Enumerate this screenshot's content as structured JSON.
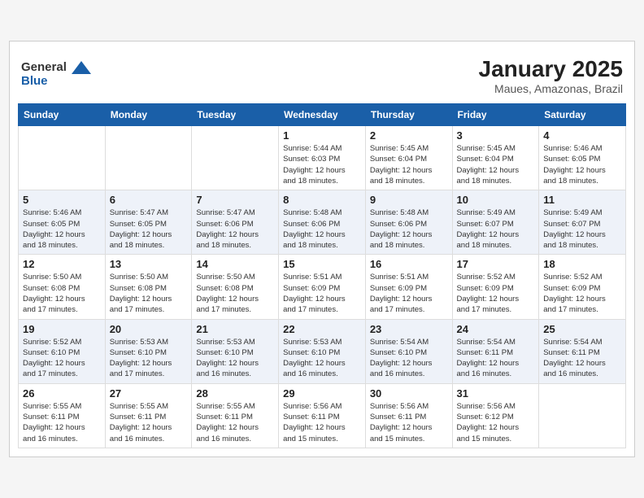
{
  "header": {
    "logo_general": "General",
    "logo_blue": "Blue",
    "title": "January 2025",
    "subtitle": "Maues, Amazonas, Brazil"
  },
  "weekdays": [
    "Sunday",
    "Monday",
    "Tuesday",
    "Wednesday",
    "Thursday",
    "Friday",
    "Saturday"
  ],
  "rows": [
    [
      {
        "day": "",
        "info": ""
      },
      {
        "day": "",
        "info": ""
      },
      {
        "day": "",
        "info": ""
      },
      {
        "day": "1",
        "info": "Sunrise: 5:44 AM\nSunset: 6:03 PM\nDaylight: 12 hours\nand 18 minutes."
      },
      {
        "day": "2",
        "info": "Sunrise: 5:45 AM\nSunset: 6:04 PM\nDaylight: 12 hours\nand 18 minutes."
      },
      {
        "day": "3",
        "info": "Sunrise: 5:45 AM\nSunset: 6:04 PM\nDaylight: 12 hours\nand 18 minutes."
      },
      {
        "day": "4",
        "info": "Sunrise: 5:46 AM\nSunset: 6:05 PM\nDaylight: 12 hours\nand 18 minutes."
      }
    ],
    [
      {
        "day": "5",
        "info": "Sunrise: 5:46 AM\nSunset: 6:05 PM\nDaylight: 12 hours\nand 18 minutes."
      },
      {
        "day": "6",
        "info": "Sunrise: 5:47 AM\nSunset: 6:05 PM\nDaylight: 12 hours\nand 18 minutes."
      },
      {
        "day": "7",
        "info": "Sunrise: 5:47 AM\nSunset: 6:06 PM\nDaylight: 12 hours\nand 18 minutes."
      },
      {
        "day": "8",
        "info": "Sunrise: 5:48 AM\nSunset: 6:06 PM\nDaylight: 12 hours\nand 18 minutes."
      },
      {
        "day": "9",
        "info": "Sunrise: 5:48 AM\nSunset: 6:06 PM\nDaylight: 12 hours\nand 18 minutes."
      },
      {
        "day": "10",
        "info": "Sunrise: 5:49 AM\nSunset: 6:07 PM\nDaylight: 12 hours\nand 18 minutes."
      },
      {
        "day": "11",
        "info": "Sunrise: 5:49 AM\nSunset: 6:07 PM\nDaylight: 12 hours\nand 18 minutes."
      }
    ],
    [
      {
        "day": "12",
        "info": "Sunrise: 5:50 AM\nSunset: 6:08 PM\nDaylight: 12 hours\nand 17 minutes."
      },
      {
        "day": "13",
        "info": "Sunrise: 5:50 AM\nSunset: 6:08 PM\nDaylight: 12 hours\nand 17 minutes."
      },
      {
        "day": "14",
        "info": "Sunrise: 5:50 AM\nSunset: 6:08 PM\nDaylight: 12 hours\nand 17 minutes."
      },
      {
        "day": "15",
        "info": "Sunrise: 5:51 AM\nSunset: 6:09 PM\nDaylight: 12 hours\nand 17 minutes."
      },
      {
        "day": "16",
        "info": "Sunrise: 5:51 AM\nSunset: 6:09 PM\nDaylight: 12 hours\nand 17 minutes."
      },
      {
        "day": "17",
        "info": "Sunrise: 5:52 AM\nSunset: 6:09 PM\nDaylight: 12 hours\nand 17 minutes."
      },
      {
        "day": "18",
        "info": "Sunrise: 5:52 AM\nSunset: 6:09 PM\nDaylight: 12 hours\nand 17 minutes."
      }
    ],
    [
      {
        "day": "19",
        "info": "Sunrise: 5:52 AM\nSunset: 6:10 PM\nDaylight: 12 hours\nand 17 minutes."
      },
      {
        "day": "20",
        "info": "Sunrise: 5:53 AM\nSunset: 6:10 PM\nDaylight: 12 hours\nand 17 minutes."
      },
      {
        "day": "21",
        "info": "Sunrise: 5:53 AM\nSunset: 6:10 PM\nDaylight: 12 hours\nand 16 minutes."
      },
      {
        "day": "22",
        "info": "Sunrise: 5:53 AM\nSunset: 6:10 PM\nDaylight: 12 hours\nand 16 minutes."
      },
      {
        "day": "23",
        "info": "Sunrise: 5:54 AM\nSunset: 6:10 PM\nDaylight: 12 hours\nand 16 minutes."
      },
      {
        "day": "24",
        "info": "Sunrise: 5:54 AM\nSunset: 6:11 PM\nDaylight: 12 hours\nand 16 minutes."
      },
      {
        "day": "25",
        "info": "Sunrise: 5:54 AM\nSunset: 6:11 PM\nDaylight: 12 hours\nand 16 minutes."
      }
    ],
    [
      {
        "day": "26",
        "info": "Sunrise: 5:55 AM\nSunset: 6:11 PM\nDaylight: 12 hours\nand 16 minutes."
      },
      {
        "day": "27",
        "info": "Sunrise: 5:55 AM\nSunset: 6:11 PM\nDaylight: 12 hours\nand 16 minutes."
      },
      {
        "day": "28",
        "info": "Sunrise: 5:55 AM\nSunset: 6:11 PM\nDaylight: 12 hours\nand 16 minutes."
      },
      {
        "day": "29",
        "info": "Sunrise: 5:56 AM\nSunset: 6:11 PM\nDaylight: 12 hours\nand 15 minutes."
      },
      {
        "day": "30",
        "info": "Sunrise: 5:56 AM\nSunset: 6:11 PM\nDaylight: 12 hours\nand 15 minutes."
      },
      {
        "day": "31",
        "info": "Sunrise: 5:56 AM\nSunset: 6:12 PM\nDaylight: 12 hours\nand 15 minutes."
      },
      {
        "day": "",
        "info": ""
      }
    ]
  ]
}
